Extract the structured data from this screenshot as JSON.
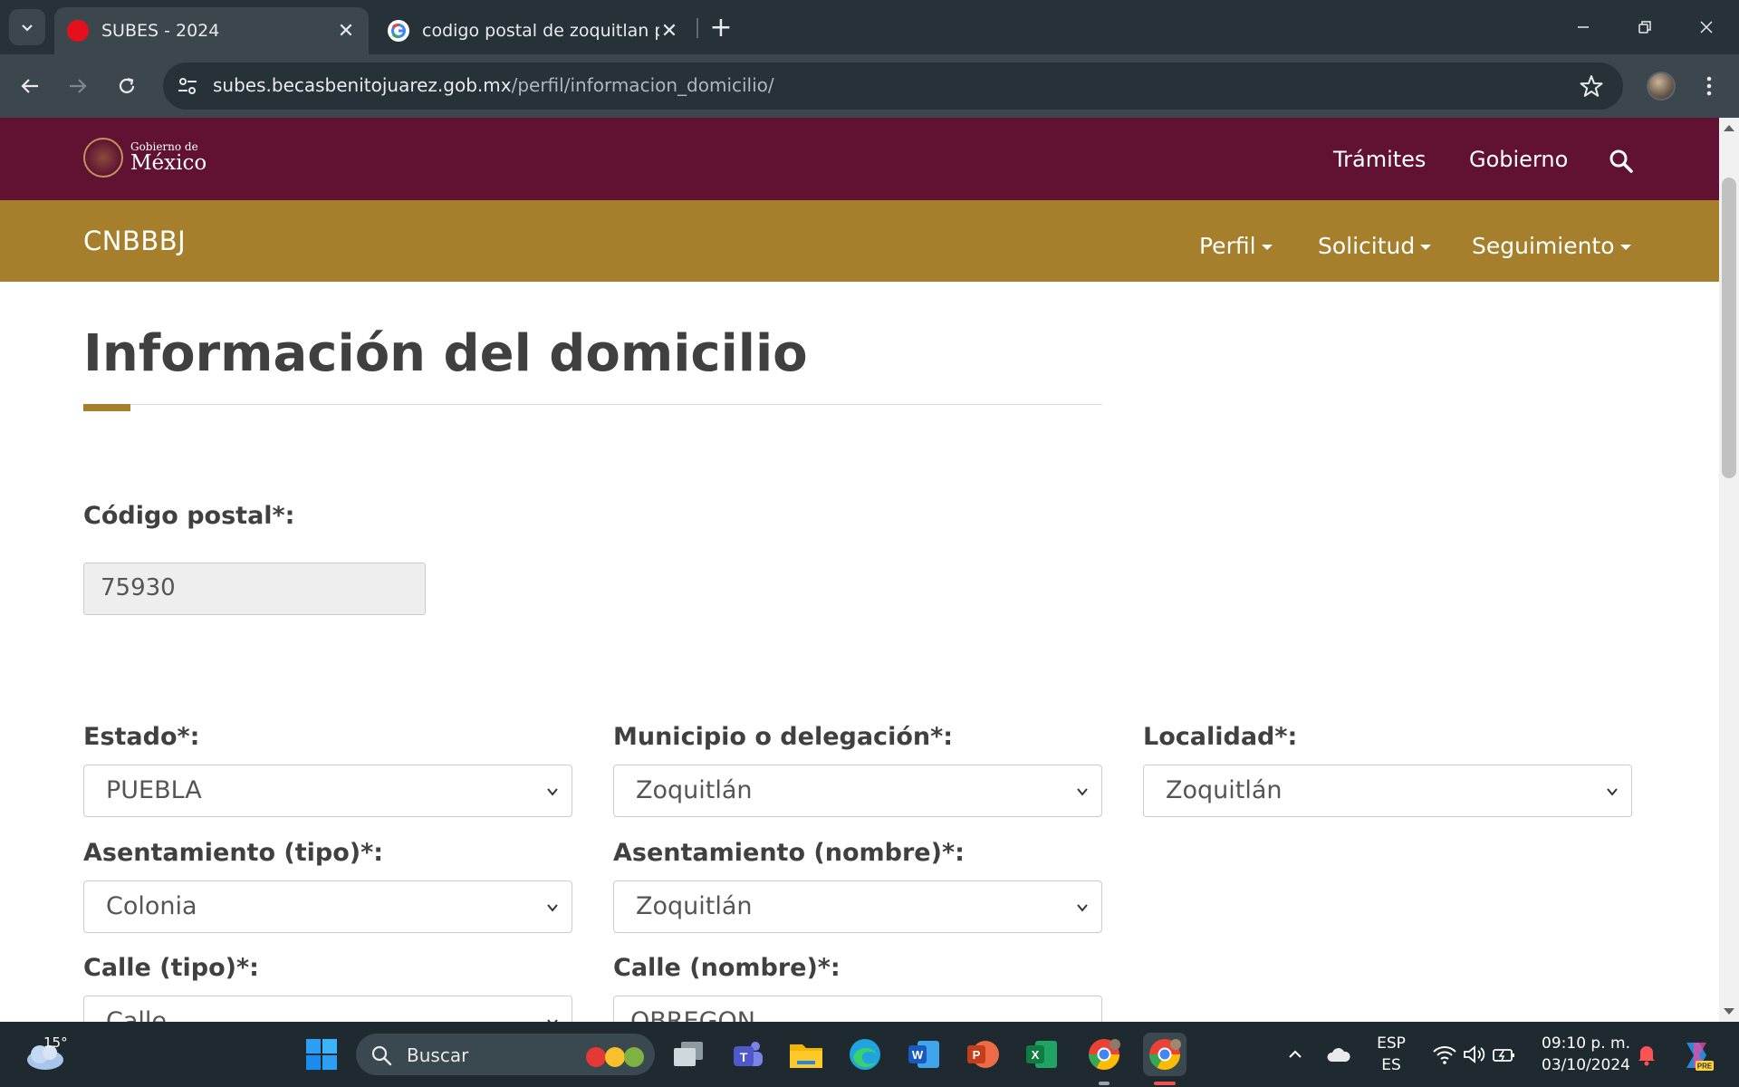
{
  "browser": {
    "tabs": [
      {
        "title": "SUBES - 2024",
        "active": true,
        "favicon_color": "#e5101e"
      },
      {
        "title": "codigo postal de zoquitlan puebla",
        "active": false,
        "favicon_color": "#4285f4"
      }
    ],
    "url_host": "subes.becasbenitojuarez.gob.mx",
    "url_path": "/perfil/informacion_domicilio/"
  },
  "gov_header": {
    "logo_small": "Gobierno de",
    "logo_big": "México",
    "links": [
      "Trámites",
      "Gobierno"
    ],
    "background": "#611232"
  },
  "sub_header": {
    "title": "CNBBBJ",
    "menus": [
      "Perfil",
      "Solicitud",
      "Seguimiento"
    ],
    "background": "#a57f2c"
  },
  "page": {
    "heading": "Información del domicilio",
    "postal_code": {
      "label": "Código postal*:",
      "value": "75930"
    },
    "estado": {
      "label": "Estado*:",
      "value": "PUEBLA"
    },
    "municipio": {
      "label": "Municipio o delegación*:",
      "value": "Zoquitlán"
    },
    "localidad": {
      "label": "Localidad*:",
      "value": "Zoquitlán"
    },
    "asentamiento_tipo": {
      "label": "Asentamiento (tipo)*:",
      "value": "Colonia"
    },
    "asentamiento_nombre": {
      "label": "Asentamiento (nombre)*:",
      "value": "Zoquitlán"
    },
    "calle_tipo": {
      "label": "Calle (tipo)*:",
      "value": "Calle"
    },
    "calle_nombre": {
      "label": "Calle (nombre)*:",
      "value": "OBREGON"
    }
  },
  "taskbar": {
    "weather_temp": "15°",
    "search_placeholder": "Buscar",
    "language_top": "ESP",
    "language_bottom": "ES",
    "time": "09:10 p. m.",
    "date": "03/10/2024"
  }
}
